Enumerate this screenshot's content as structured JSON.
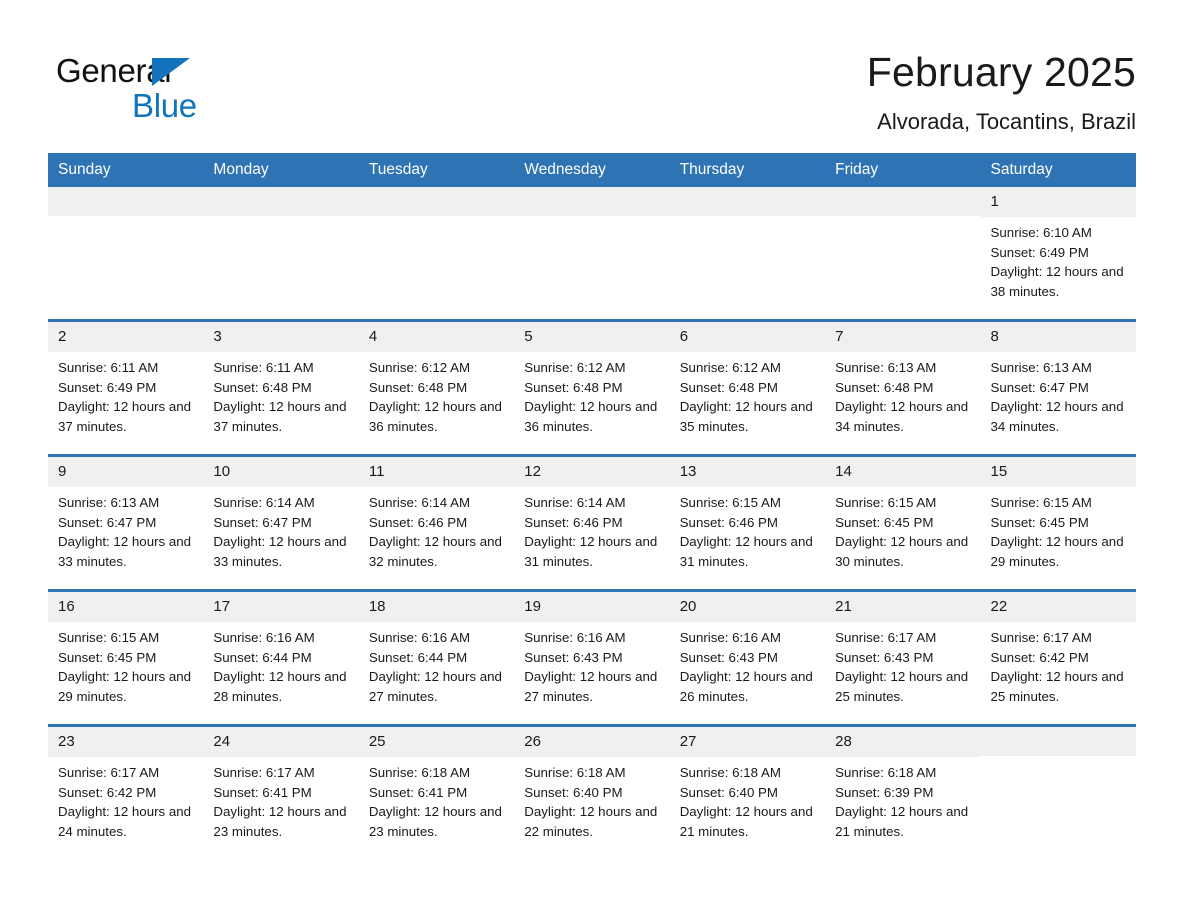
{
  "brand": {
    "word_general": "General",
    "word_blue": "Blue",
    "accent_color": "#1473bc",
    "blue_text_color": "#0f75bd"
  },
  "header": {
    "title": "February 2025",
    "subtitle": "Alvorada, Tocantins, Brazil"
  },
  "theme": {
    "header_blue": "#2e73b4",
    "daynum_band": "#f0f0f0",
    "cell_background": "#ffffff",
    "text_color": "#1a1a1a"
  },
  "calendar": {
    "weekday_headers": [
      "Sunday",
      "Monday",
      "Tuesday",
      "Wednesday",
      "Thursday",
      "Friday",
      "Saturday"
    ],
    "labels": {
      "sunrise_prefix": "Sunrise:",
      "sunset_prefix": "Sunset:",
      "daylight_prefix": "Daylight:"
    },
    "weeks": [
      [
        {
          "day": "",
          "empty": true
        },
        {
          "day": "",
          "empty": true
        },
        {
          "day": "",
          "empty": true
        },
        {
          "day": "",
          "empty": true
        },
        {
          "day": "",
          "empty": true
        },
        {
          "day": "",
          "empty": true
        },
        {
          "day": "1",
          "sunrise": "Sunrise: 6:10 AM",
          "sunset": "Sunset: 6:49 PM",
          "daylight": "Daylight: 12 hours and 38 minutes."
        }
      ],
      [
        {
          "day": "2",
          "sunrise": "Sunrise: 6:11 AM",
          "sunset": "Sunset: 6:49 PM",
          "daylight": "Daylight: 12 hours and 37 minutes."
        },
        {
          "day": "3",
          "sunrise": "Sunrise: 6:11 AM",
          "sunset": "Sunset: 6:48 PM",
          "daylight": "Daylight: 12 hours and 37 minutes."
        },
        {
          "day": "4",
          "sunrise": "Sunrise: 6:12 AM",
          "sunset": "Sunset: 6:48 PM",
          "daylight": "Daylight: 12 hours and 36 minutes."
        },
        {
          "day": "5",
          "sunrise": "Sunrise: 6:12 AM",
          "sunset": "Sunset: 6:48 PM",
          "daylight": "Daylight: 12 hours and 36 minutes."
        },
        {
          "day": "6",
          "sunrise": "Sunrise: 6:12 AM",
          "sunset": "Sunset: 6:48 PM",
          "daylight": "Daylight: 12 hours and 35 minutes."
        },
        {
          "day": "7",
          "sunrise": "Sunrise: 6:13 AM",
          "sunset": "Sunset: 6:48 PM",
          "daylight": "Daylight: 12 hours and 34 minutes."
        },
        {
          "day": "8",
          "sunrise": "Sunrise: 6:13 AM",
          "sunset": "Sunset: 6:47 PM",
          "daylight": "Daylight: 12 hours and 34 minutes."
        }
      ],
      [
        {
          "day": "9",
          "sunrise": "Sunrise: 6:13 AM",
          "sunset": "Sunset: 6:47 PM",
          "daylight": "Daylight: 12 hours and 33 minutes."
        },
        {
          "day": "10",
          "sunrise": "Sunrise: 6:14 AM",
          "sunset": "Sunset: 6:47 PM",
          "daylight": "Daylight: 12 hours and 33 minutes."
        },
        {
          "day": "11",
          "sunrise": "Sunrise: 6:14 AM",
          "sunset": "Sunset: 6:46 PM",
          "daylight": "Daylight: 12 hours and 32 minutes."
        },
        {
          "day": "12",
          "sunrise": "Sunrise: 6:14 AM",
          "sunset": "Sunset: 6:46 PM",
          "daylight": "Daylight: 12 hours and 31 minutes."
        },
        {
          "day": "13",
          "sunrise": "Sunrise: 6:15 AM",
          "sunset": "Sunset: 6:46 PM",
          "daylight": "Daylight: 12 hours and 31 minutes."
        },
        {
          "day": "14",
          "sunrise": "Sunrise: 6:15 AM",
          "sunset": "Sunset: 6:45 PM",
          "daylight": "Daylight: 12 hours and 30 minutes."
        },
        {
          "day": "15",
          "sunrise": "Sunrise: 6:15 AM",
          "sunset": "Sunset: 6:45 PM",
          "daylight": "Daylight: 12 hours and 29 minutes."
        }
      ],
      [
        {
          "day": "16",
          "sunrise": "Sunrise: 6:15 AM",
          "sunset": "Sunset: 6:45 PM",
          "daylight": "Daylight: 12 hours and 29 minutes."
        },
        {
          "day": "17",
          "sunrise": "Sunrise: 6:16 AM",
          "sunset": "Sunset: 6:44 PM",
          "daylight": "Daylight: 12 hours and 28 minutes."
        },
        {
          "day": "18",
          "sunrise": "Sunrise: 6:16 AM",
          "sunset": "Sunset: 6:44 PM",
          "daylight": "Daylight: 12 hours and 27 minutes."
        },
        {
          "day": "19",
          "sunrise": "Sunrise: 6:16 AM",
          "sunset": "Sunset: 6:43 PM",
          "daylight": "Daylight: 12 hours and 27 minutes."
        },
        {
          "day": "20",
          "sunrise": "Sunrise: 6:16 AM",
          "sunset": "Sunset: 6:43 PM",
          "daylight": "Daylight: 12 hours and 26 minutes."
        },
        {
          "day": "21",
          "sunrise": "Sunrise: 6:17 AM",
          "sunset": "Sunset: 6:43 PM",
          "daylight": "Daylight: 12 hours and 25 minutes."
        },
        {
          "day": "22",
          "sunrise": "Sunrise: 6:17 AM",
          "sunset": "Sunset: 6:42 PM",
          "daylight": "Daylight: 12 hours and 25 minutes."
        }
      ],
      [
        {
          "day": "23",
          "sunrise": "Sunrise: 6:17 AM",
          "sunset": "Sunset: 6:42 PM",
          "daylight": "Daylight: 12 hours and 24 minutes."
        },
        {
          "day": "24",
          "sunrise": "Sunrise: 6:17 AM",
          "sunset": "Sunset: 6:41 PM",
          "daylight": "Daylight: 12 hours and 23 minutes."
        },
        {
          "day": "25",
          "sunrise": "Sunrise: 6:18 AM",
          "sunset": "Sunset: 6:41 PM",
          "daylight": "Daylight: 12 hours and 23 minutes."
        },
        {
          "day": "26",
          "sunrise": "Sunrise: 6:18 AM",
          "sunset": "Sunset: 6:40 PM",
          "daylight": "Daylight: 12 hours and 22 minutes."
        },
        {
          "day": "27",
          "sunrise": "Sunrise: 6:18 AM",
          "sunset": "Sunset: 6:40 PM",
          "daylight": "Daylight: 12 hours and 21 minutes."
        },
        {
          "day": "28",
          "sunrise": "Sunrise: 6:18 AM",
          "sunset": "Sunset: 6:39 PM",
          "daylight": "Daylight: 12 hours and 21 minutes."
        },
        {
          "day": "",
          "empty": true
        }
      ]
    ]
  }
}
